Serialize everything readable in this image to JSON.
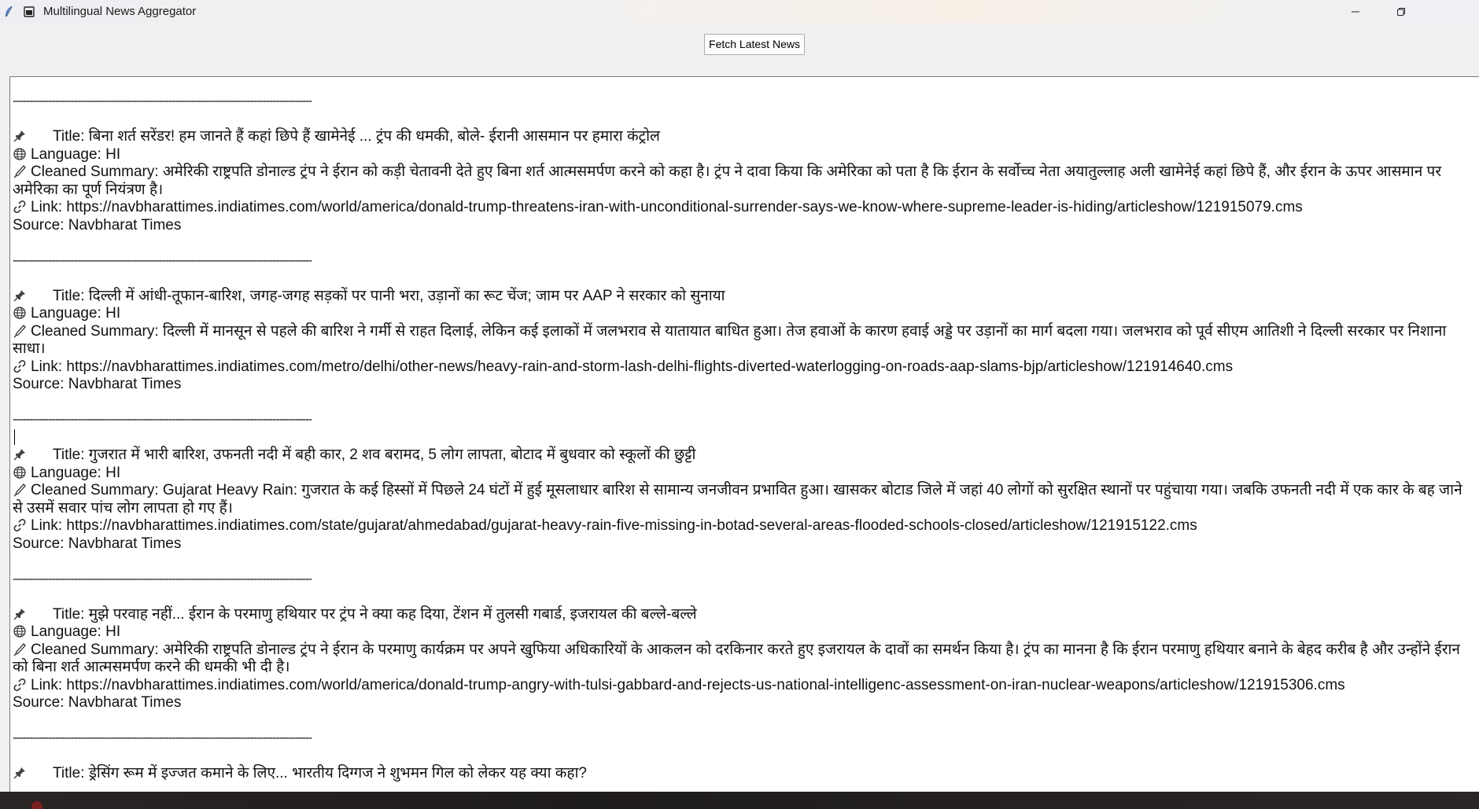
{
  "window": {
    "title": "Multilingual News Aggregator"
  },
  "toolbar": {
    "fetch_label": "Fetch Latest News"
  },
  "separator_text": "--------------------------------------------------------------------------------------------",
  "labels": {
    "title_prefix": "Title: ",
    "language_prefix": "Language: ",
    "summary_prefix": "Cleaned Summary: ",
    "link_prefix": "Link: ",
    "source_prefix": "Source: "
  },
  "icons": {
    "title": "pushpin-icon",
    "language": "globe-icon",
    "summary": "pen-icon",
    "link": "link-icon"
  },
  "articles": [
    {
      "title": "बिना शर्त सरेंडर! हम जानते हैं कहां छिपे हैं खामेनेई ... ट्रंप की धमकी, बोले- ईरानी आसमान पर हमारा कंट्रोल",
      "language": "HI",
      "summary": "अमेरिकी राष्ट्रपति डोनाल्ड ट्रंप ने ईरान को कड़ी चेतावनी देते हुए बिना शर्त आत्मसमर्पण करने को कहा है। ट्रंप ने दावा किया कि अमेरिका को पता है कि ईरान के सर्वोच्च नेता अयातुल्लाह अली खामेनेई कहां छिपे हैं, और ईरान के ऊपर आसमान पर अमेरिका का पूर्ण नियंत्रण है।",
      "link": "https://navbharattimes.indiatimes.com/world/america/donald-trump-threatens-iran-with-unconditional-surrender-says-we-know-where-supreme-leader-is-hiding/articleshow/121915079.cms",
      "source": "Navbharat Times"
    },
    {
      "title": "दिल्ली में आंधी-तूफान-बारिश, जगह-जगह सड़कों पर पानी भरा, उड़ानों का रूट चेंज; जाम पर AAP ने सरकार को सुनाया",
      "language": "HI",
      "summary": "दिल्ली में मानसून से पहले की बारिश ने गर्मी से राहत दिलाई, लेकिन कई इलाकों में जलभराव से यातायात बाधित हुआ। तेज हवाओं के कारण हवाई अड्डे पर उड़ानों का मार्ग बदला गया। जलभराव को पूर्व सीएम आतिशी ने दिल्ली सरकार पर निशाना साधा।",
      "link": "https://navbharattimes.indiatimes.com/metro/delhi/other-news/heavy-rain-and-storm-lash-delhi-flights-diverted-waterlogging-on-roads-aap-slams-bjp/articleshow/121914640.cms",
      "source": "Navbharat Times"
    },
    {
      "title": "गुजरात में भारी बारिश, उफनती नदी में बही कार, 2 शव बरामद, 5 लोग लापता, बोटाद में बुधवार को स्कूलों की छुट्टी",
      "language": "HI",
      "summary": "Gujarat Heavy Rain: गुजरात के कई हिस्सों में पिछले 24 घंटों में हुई मूसलाधार बारिश से सामान्य जनजीवन प्रभावित हुआ। खासकर बोटाड जिले में जहां 40 लोगों को सुरक्षित स्थानों पर पहुंचाया गया। जबकि उफनती नदी में एक कार के बह जाने से उसमें सवार पांच लोग लापता हो गए हैं।",
      "link": "https://navbharattimes.indiatimes.com/state/gujarat/ahmedabad/gujarat-heavy-rain-five-missing-in-botad-several-areas-flooded-schools-closed/articleshow/121915122.cms",
      "source": "Navbharat Times"
    },
    {
      "title": "मुझे परवाह नहीं... ईरान के परमाणु हथियार पर ट्रंप ने क्या कह दिया, टेंशन में तुलसी गबार्ड, इजरायल की बल्ले-बल्ले",
      "language": "HI",
      "summary": "अमेरिकी राष्ट्रपति डोनाल्ड ट्रंप ने ईरान के परमाणु कार्यक्रम पर अपने खुफिया अधिकारियों के आकलन को दरकिनार करते हुए इजरायल के दावों का समर्थन किया है। ट्रंप का मानना है कि ईरान परमाणु हथियार बनाने के बेहद करीब है और उन्होंने ईरान को बिना शर्त आत्मसमर्पण करने की धमकी भी दी है।",
      "link": "https://navbharattimes.indiatimes.com/world/america/donald-trump-angry-with-tulsi-gabbard-and-rejects-us-national-intelligenc-assessment-on-iran-nuclear-weapons/articleshow/121915306.cms",
      "source": "Navbharat Times"
    },
    {
      "title": "ड्रेसिंग रूम में इज्जत कमाने के लिए... भारतीय दिग्गज ने शुभमन गिल को लेकर यह क्या कहा?"
    }
  ]
}
